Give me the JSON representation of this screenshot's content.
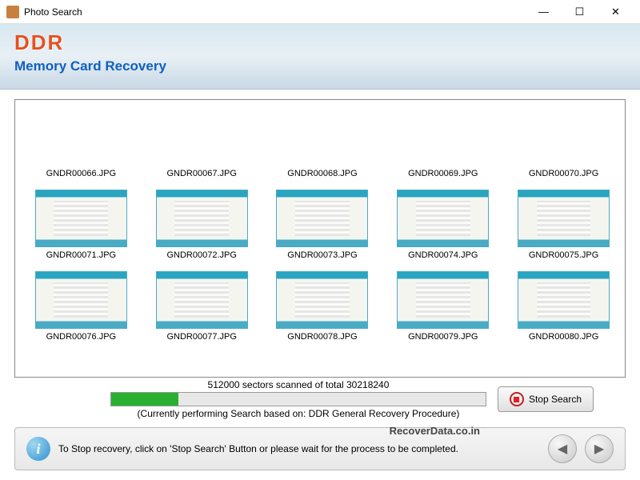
{
  "window": {
    "title": "Photo Search"
  },
  "header": {
    "logo": "DDR",
    "subtitle": "Memory Card Recovery"
  },
  "thumbs": [
    {
      "label": "GNDR00066.JPG",
      "placeholder": true
    },
    {
      "label": "GNDR00067.JPG",
      "placeholder": true
    },
    {
      "label": "GNDR00068.JPG",
      "placeholder": true
    },
    {
      "label": "GNDR00069.JPG",
      "placeholder": true
    },
    {
      "label": "GNDR00070.JPG",
      "placeholder": true
    },
    {
      "label": "GNDR00071.JPG"
    },
    {
      "label": "GNDR00072.JPG"
    },
    {
      "label": "GNDR00073.JPG"
    },
    {
      "label": "GNDR00074.JPG"
    },
    {
      "label": "GNDR00075.JPG"
    },
    {
      "label": "GNDR00076.JPG"
    },
    {
      "label": "GNDR00077.JPG"
    },
    {
      "label": "GNDR00078.JPG"
    },
    {
      "label": "GNDR00079.JPG"
    },
    {
      "label": "GNDR00080.JPG"
    }
  ],
  "progress": {
    "text": "512000 sectors scanned of total 30218240",
    "percent": 18,
    "subtext": "(Currently performing Search based on:  DDR General Recovery Procedure)",
    "stop_label": "Stop Search"
  },
  "footer": {
    "text": "To Stop recovery, click on 'Stop Search' Button or please wait for the process to be completed."
  },
  "watermark": "RecoverData.co.in"
}
